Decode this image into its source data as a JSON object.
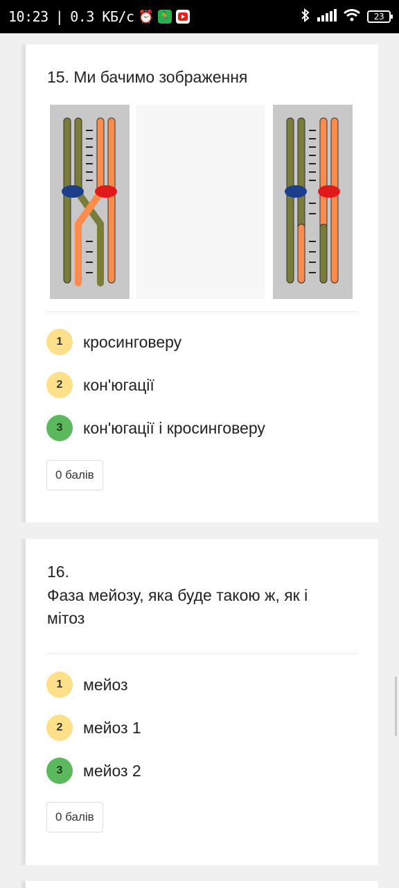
{
  "status_bar": {
    "time": "10:23",
    "separator": "|",
    "network_speed": "0.3 КБ/с",
    "battery_level": "23",
    "icons": [
      "alarm-icon",
      "run-icon",
      "youtube-icon",
      "bluetooth-icon",
      "signal-icon",
      "wifi-icon",
      "battery-icon"
    ]
  },
  "questions": [
    {
      "title": "15. Ми бачимо зображення",
      "options": [
        {
          "num": "1",
          "text": "кросинговеру",
          "state": "yellow"
        },
        {
          "num": "2",
          "text": "кон'югації",
          "state": "yellow"
        },
        {
          "num": "3",
          "text": "кон'югації і кросинговеру",
          "state": "green"
        }
      ],
      "score": "0 балів"
    },
    {
      "title_line1": "16.",
      "title_line2": "Фаза мейозу, яка буде такою ж, як і",
      "title_line3": "мітоз",
      "options": [
        {
          "num": "1",
          "text": "мейоз",
          "state": "yellow"
        },
        {
          "num": "2",
          "text": "мейоз 1",
          "state": "yellow"
        },
        {
          "num": "3",
          "text": "мейоз 2",
          "state": "green"
        }
      ],
      "score": "0 балів"
    }
  ],
  "colors": {
    "badge_yellow": "#fde089",
    "badge_green": "#5cb85c",
    "chromatid_olive": "#7a7d3a",
    "chromatid_orange": "#ff8c4a",
    "centromere_blue": "#1c3f8c",
    "centromere_red": "#e01a1a"
  }
}
